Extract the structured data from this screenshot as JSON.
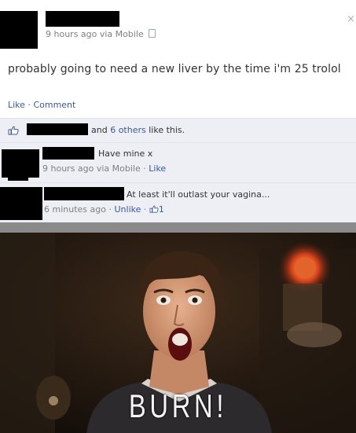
{
  "post": {
    "timestamp": "9 hours ago via Mobile",
    "status_text": "probably going to need a new liver by the time i'm 25 trolol",
    "close_glyph": "×",
    "actions": {
      "like": "Like",
      "sep": " · ",
      "comment": "Comment"
    }
  },
  "likes": {
    "and_text": "and",
    "others_link": "6 others",
    "suffix": "like this."
  },
  "comments": [
    {
      "text": "Have mine x",
      "meta": "9 hours ago via Mobile",
      "sep": " · ",
      "action": "Like"
    },
    {
      "text": "At least it'll outlast your vagina...",
      "meta": "6 minutes ago",
      "sep": " · ",
      "action": "Unlike",
      "sep2": " · ",
      "like_count": "1"
    }
  ],
  "meme": {
    "caption": "BURN!"
  },
  "colors": {
    "link": "#3b5998",
    "ufi_bg": "#edeff4",
    "meta": "#7f7f7f"
  },
  "icons": [
    "close-icon",
    "mobile-phone-icon",
    "thumbs-up-icon"
  ]
}
